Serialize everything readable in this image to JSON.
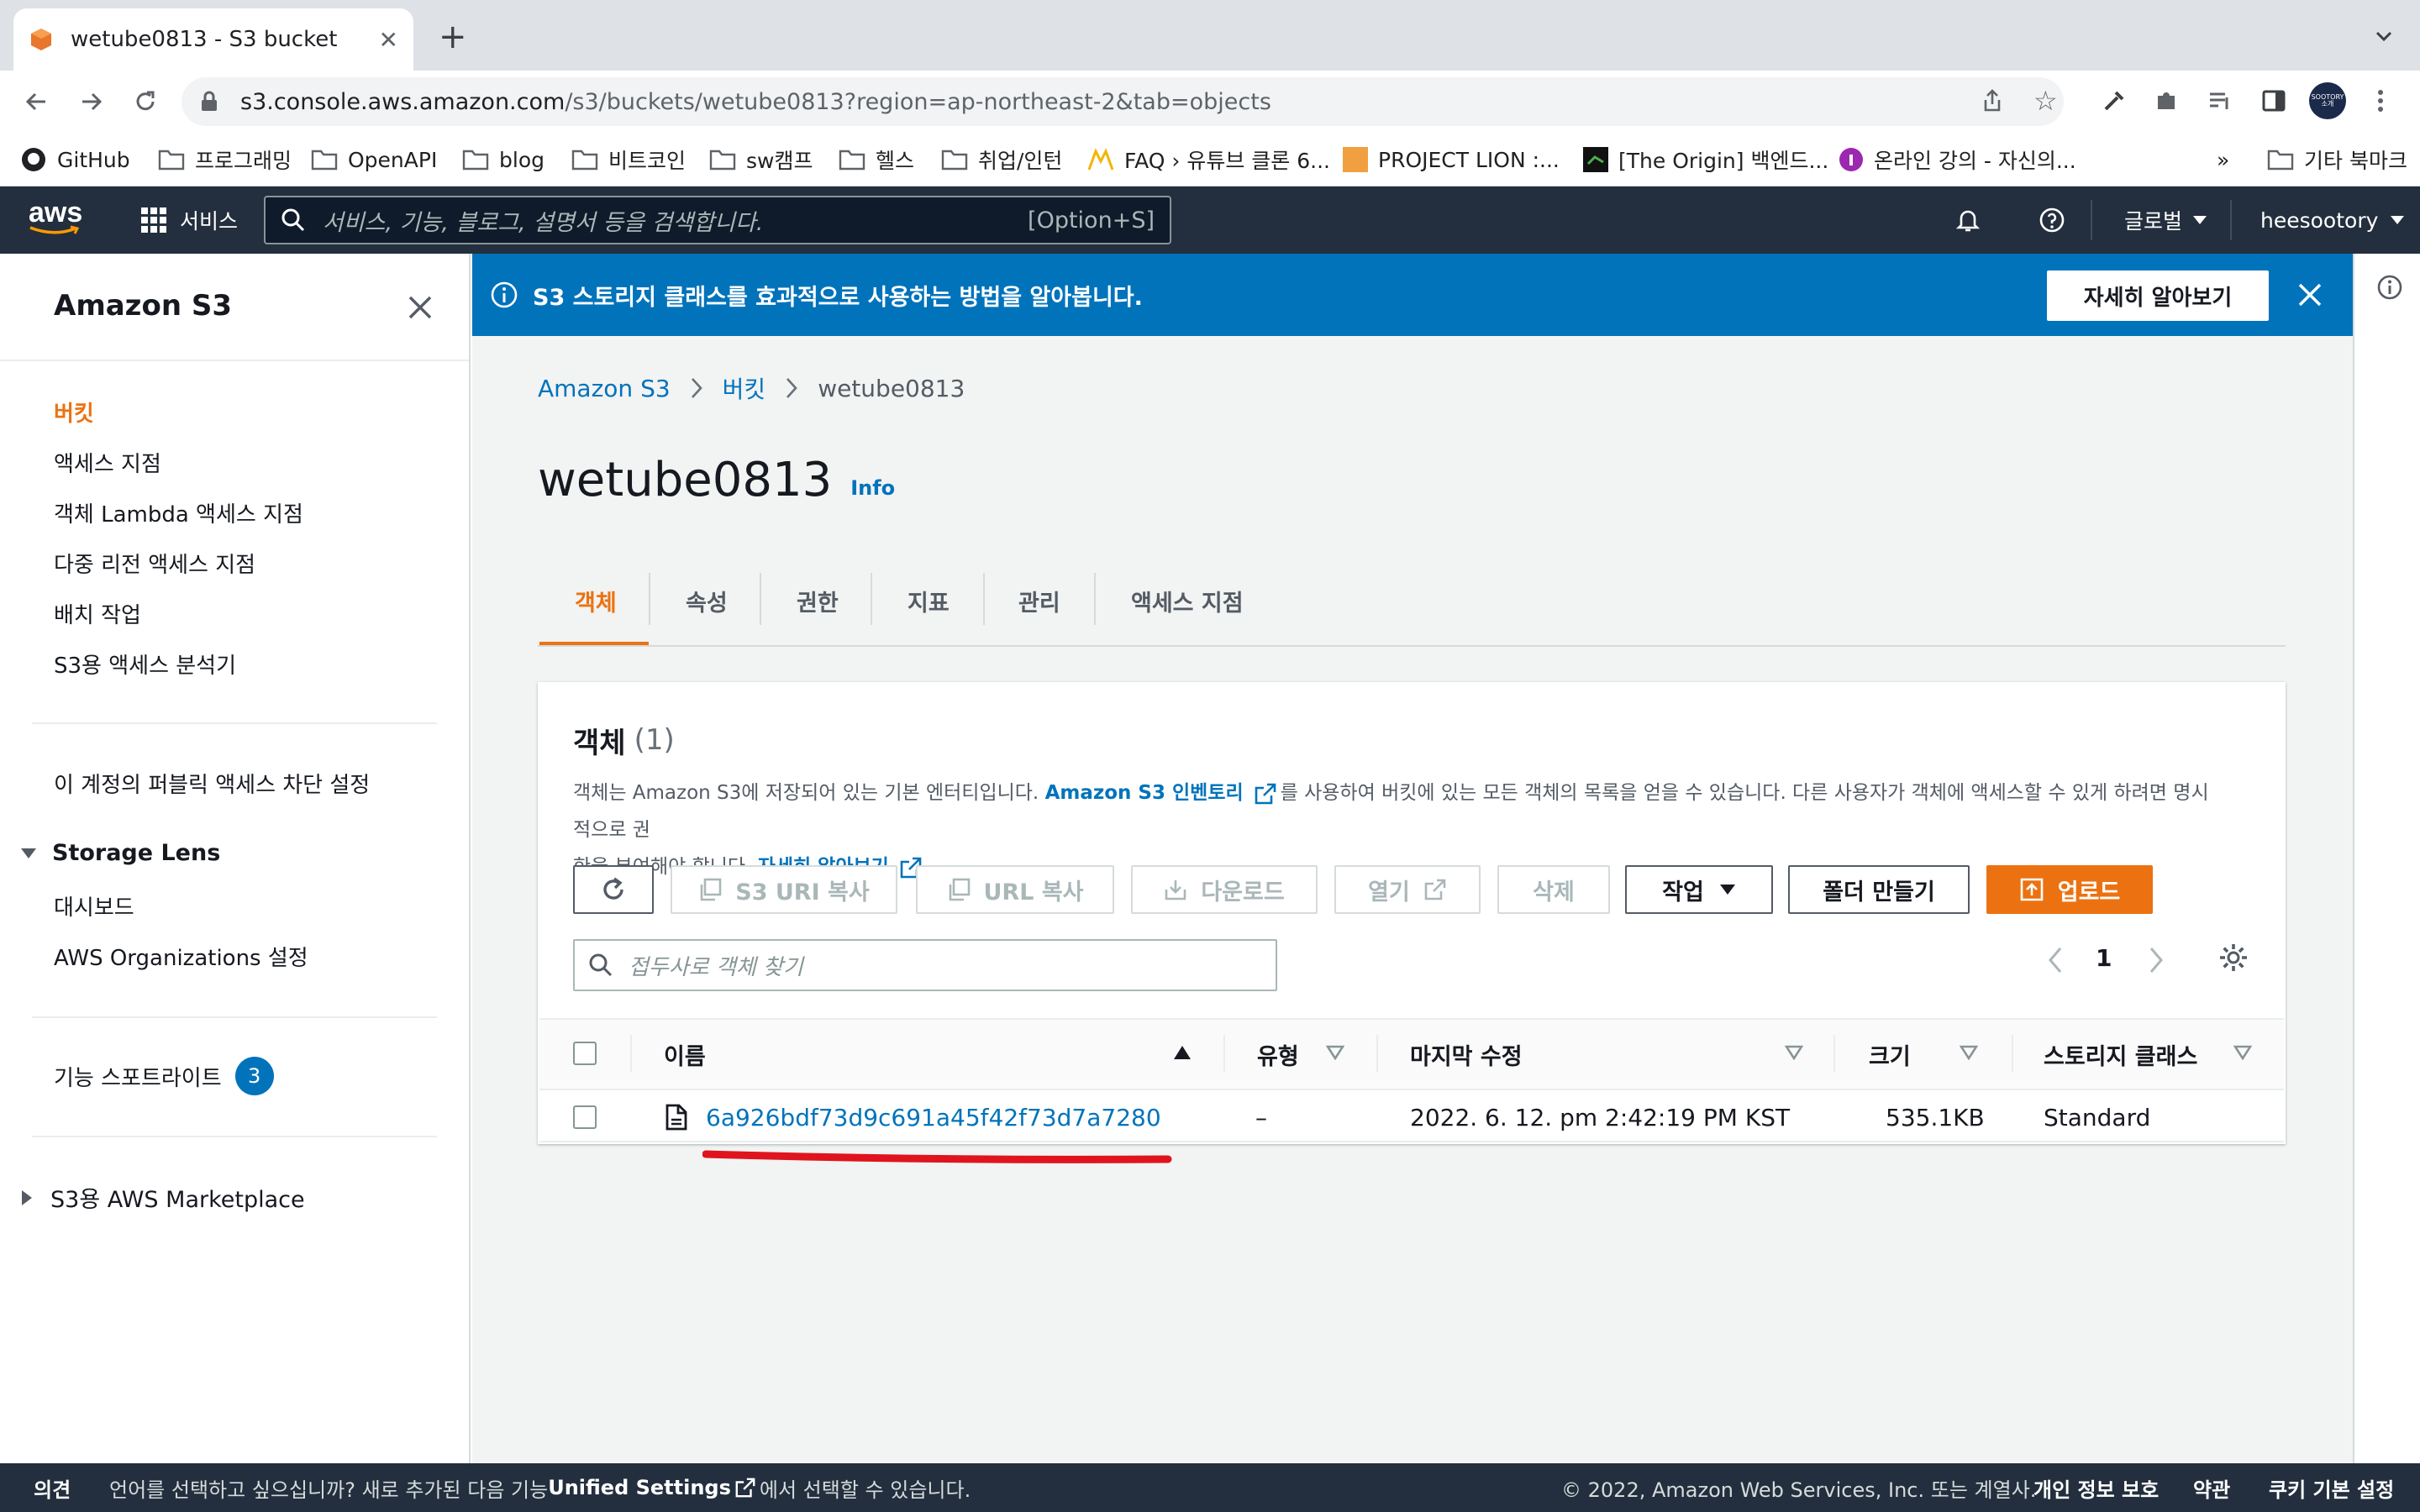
{
  "browser": {
    "tab_title": "wetube0813 - S3 bucket",
    "url_host": "s3.console.aws.amazon.com",
    "url_path": "/s3/buckets/wetube0813?region=ap-northeast-2&tab=objects",
    "profile_label": "SOOTORY 소개"
  },
  "bookmarks": [
    "GitHub",
    "프로그래밍",
    "OpenAPI",
    "blog",
    "비트코인",
    "sw캠프",
    "헬스",
    "취업/인턴",
    "FAQ › 유튜브 클론 6...",
    "PROJECT LION :...",
    "[The Origin] 백엔드...",
    "온라인 강의 - 자신의...",
    "»",
    "기타 북마크"
  ],
  "awsnav": {
    "logo": "aws",
    "services": "서비스",
    "search_placeholder": "서비스, 기능, 블로그, 설명서 등을 검색합니다.",
    "search_shortcut": "[Option+S]",
    "region": "글로벌",
    "user": "heesootory"
  },
  "sidebar": {
    "title": "Amazon S3",
    "items": [
      "버킷",
      "액세스 지점",
      "객체 Lambda 액세스 지점",
      "다중 리전 액세스 지점",
      "배치 작업",
      "S3용 액세스 분석기"
    ],
    "public_access": "이 계정의 퍼블릭 액세스 차단 설정",
    "storage_lens": "Storage Lens",
    "storage_lens_items": [
      "대시보드",
      "AWS Organizations 설정"
    ],
    "feature_spotlight": "기능 스포트라이트",
    "feature_spotlight_count": "3",
    "marketplace": "S3용 AWS Marketplace"
  },
  "banner": {
    "message": "S3 스토리지 클래스를 효과적으로 사용하는 방법을 알아봅니다.",
    "learn_more": "자세히 알아보기"
  },
  "breadcrumb": [
    "Amazon S3",
    "버킷",
    "wetube0813"
  ],
  "page": {
    "title": "wetube0813",
    "info": "Info"
  },
  "tabs": [
    "객체",
    "속성",
    "권한",
    "지표",
    "관리",
    "액세스 지점"
  ],
  "objects": {
    "heading": "객체",
    "count": "(1)",
    "desc_part1": "객체는 Amazon S3에 저장되어 있는 기본 엔터티입니다. ",
    "desc_link": "Amazon S3 인벤토리",
    "desc_part2": "를 사용하여 버킷에 있는 모든 객체의 목록을 얻을 수 있습니다. 다른 사용자가 객체에 액세스할 수 있게 하려면 명시적으로 권",
    "desc_part3": "한을 부여해야 합니다. ",
    "desc_link2": "자세히 알아보기",
    "buttons": {
      "copy_s3_uri": "S3 URI 복사",
      "copy_url": "URL 복사",
      "download": "다운로드",
      "open": "열기",
      "delete": "삭제",
      "actions": "작업",
      "create_folder": "폴더 만들기",
      "upload": "업로드"
    },
    "filter_placeholder": "접두사로 객체 찾기",
    "page_number": "1",
    "columns": [
      "이름",
      "유형",
      "마지막 수정",
      "크기",
      "스토리지 클래스"
    ],
    "rows": [
      {
        "name": "6a926bdf73d9c691a45f42f73d7a7280",
        "type": "–",
        "modified": "2022. 6. 12. pm 2:42:19 PM KST",
        "size": "535.1KB",
        "storage_class": "Standard"
      }
    ]
  },
  "footer": {
    "feedback": "의견",
    "language_part1": "언어를 선택하고 싶으십니까? 새로 추가된 다음 기능",
    "language_link": "Unified Settings",
    "language_part2": "에서 선택할 수 있습니다.",
    "copyright": "© 2022, Amazon Web Services, Inc. 또는 계열사.",
    "privacy": "개인 정보 보호",
    "terms": "약관",
    "cookies": "쿠키 기본 설정"
  },
  "colors": {
    "aws_nav": "#232f3e",
    "accent_orange": "#ec7211",
    "link_blue": "#0073bb",
    "annotation_red": "#e0141e"
  }
}
